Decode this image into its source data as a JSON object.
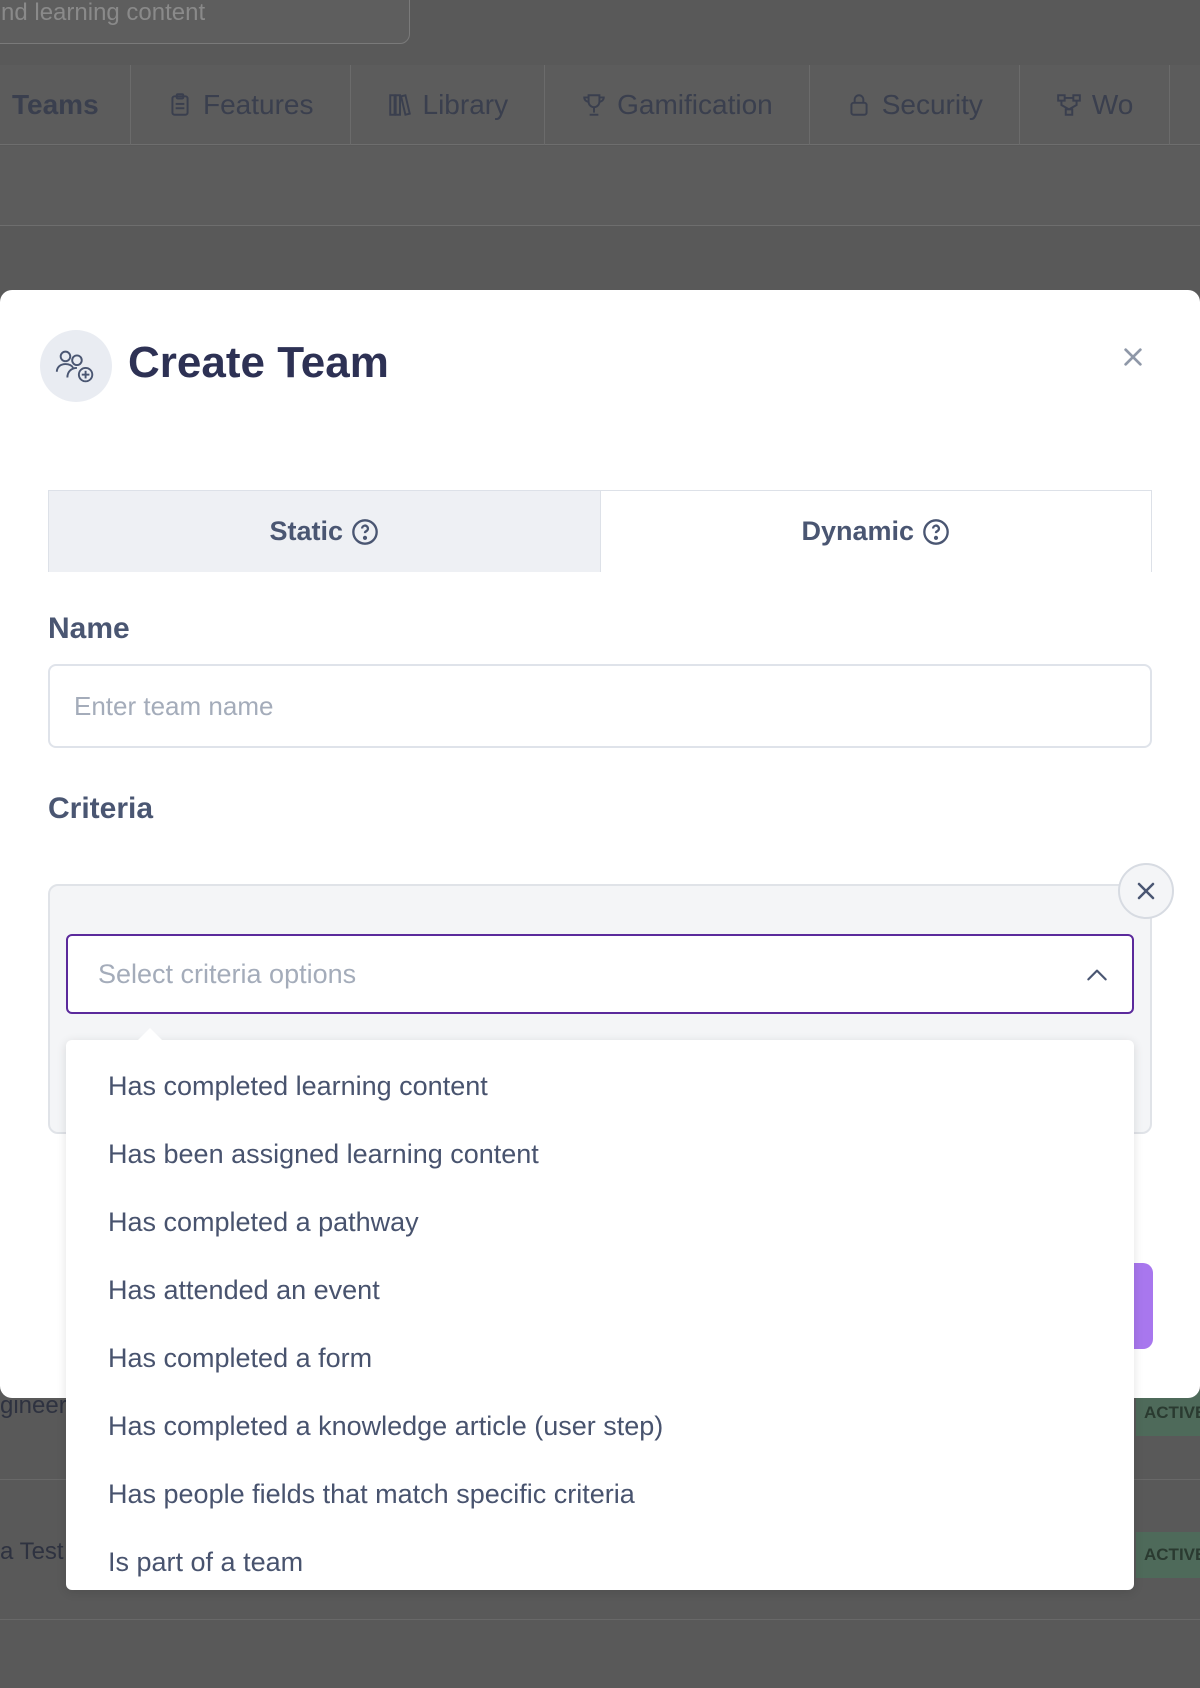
{
  "background": {
    "search_text": "nd learning content",
    "tabs": [
      {
        "label": "Teams",
        "icon": "none"
      },
      {
        "label": "Features",
        "icon": "clipboard-icon"
      },
      {
        "label": "Library",
        "icon": "books-icon"
      },
      {
        "label": "Gamification",
        "icon": "trophy-icon"
      },
      {
        "label": "Security",
        "icon": "lock-icon"
      },
      {
        "label": "Wo",
        "icon": "workflow-icon"
      }
    ],
    "rows": [
      {
        "text": "gineer",
        "status": "ACTIVE"
      },
      {
        "text": "a Test",
        "status": "ACTIVE"
      }
    ]
  },
  "modal": {
    "title": "Create Team",
    "icon": "add-team-icon",
    "tabs": [
      {
        "label": "Static",
        "icon": "help-circle-icon",
        "active": true
      },
      {
        "label": "Dynamic",
        "icon": "help-circle-icon",
        "active": false
      }
    ],
    "name_label": "Name",
    "name_placeholder": "Enter team name",
    "criteria_label": "Criteria",
    "criteria_select": {
      "placeholder": "Select criteria options",
      "options": [
        "Has completed learning content",
        "Has been assigned learning content",
        "Has completed a pathway",
        "Has attended an event",
        "Has completed a form",
        "Has completed a knowledge article (user step)",
        "Has people fields that match specific criteria",
        "Is part of a team"
      ]
    }
  },
  "colors": {
    "accent": "#5b2a9c",
    "primary_button": "#a877ee",
    "title": "#2d3154",
    "overlay": "#595959"
  }
}
